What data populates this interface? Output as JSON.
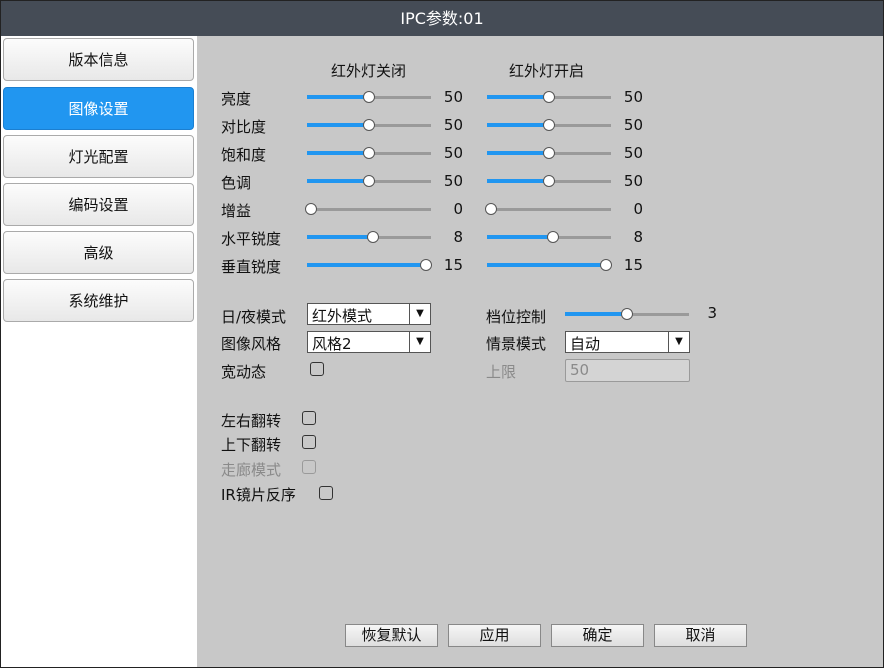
{
  "title": "IPC参数:01",
  "sidebar": {
    "items": [
      {
        "label": "版本信息"
      },
      {
        "label": "图像设置"
      },
      {
        "label": "灯光配置"
      },
      {
        "label": "编码设置"
      },
      {
        "label": "高级"
      },
      {
        "label": "系统维护"
      }
    ],
    "active": "图像设置"
  },
  "image": {
    "column_ir_off": "红外灯关闭",
    "column_ir_on": "红外灯开启",
    "rows": [
      {
        "label": "亮度",
        "ir_off": 50,
        "ir_on": 50,
        "max": 100
      },
      {
        "label": "对比度",
        "ir_off": 50,
        "ir_on": 50,
        "max": 100
      },
      {
        "label": "饱和度",
        "ir_off": 50,
        "ir_on": 50,
        "max": 100
      },
      {
        "label": "色调",
        "ir_off": 50,
        "ir_on": 50,
        "max": 100
      },
      {
        "label": "增益",
        "ir_off": 0,
        "ir_on": 0,
        "max": 100
      },
      {
        "label": "水平锐度",
        "ir_off": 8,
        "ir_on": 8,
        "max": 15
      },
      {
        "label": "垂直锐度",
        "ir_off": 15,
        "ir_on": 15,
        "max": 15
      }
    ]
  },
  "settings": {
    "day_night_label": "日/夜模式",
    "day_night_value": "红外模式",
    "style_label": "图像风格",
    "style_value": "风格2",
    "wdr_label": "宽动态",
    "gear_label": "档位控制",
    "gear_value": "3",
    "gear_level": 0.5,
    "scene_label": "情景模式",
    "scene_value": "自动",
    "upper_label": "上限",
    "upper_value": "50",
    "flip_h_label": "左右翻转",
    "flip_v_label": "上下翻转",
    "corridor_label": "走廊模式",
    "ir_reverse_label": "IR镜片反序"
  },
  "buttons": {
    "restore": "恢复默认",
    "apply": "应用",
    "ok": "确定",
    "cancel": "取消"
  },
  "colors": {
    "accent": "#2196f0",
    "titlebar": "#454c56",
    "panel": "#c8c8c8"
  }
}
